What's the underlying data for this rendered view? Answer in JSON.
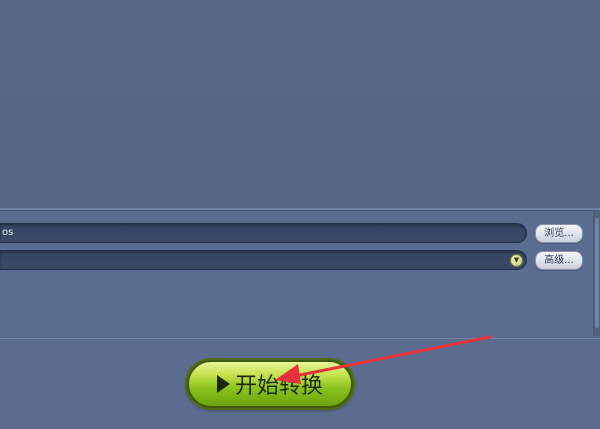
{
  "settings": {
    "output_path": "os",
    "browse_label": "浏览...",
    "advanced_label": "高级..."
  },
  "action": {
    "start_label": "开始转换"
  },
  "colors": {
    "background": "#58698a",
    "field": "#36455f",
    "start_button_green": "#89c21a",
    "annotation_arrow": "#e8323c"
  },
  "icons": {
    "play": "play-icon",
    "dropdown": "chevron-down-icon",
    "annotation": "red-arrow"
  }
}
